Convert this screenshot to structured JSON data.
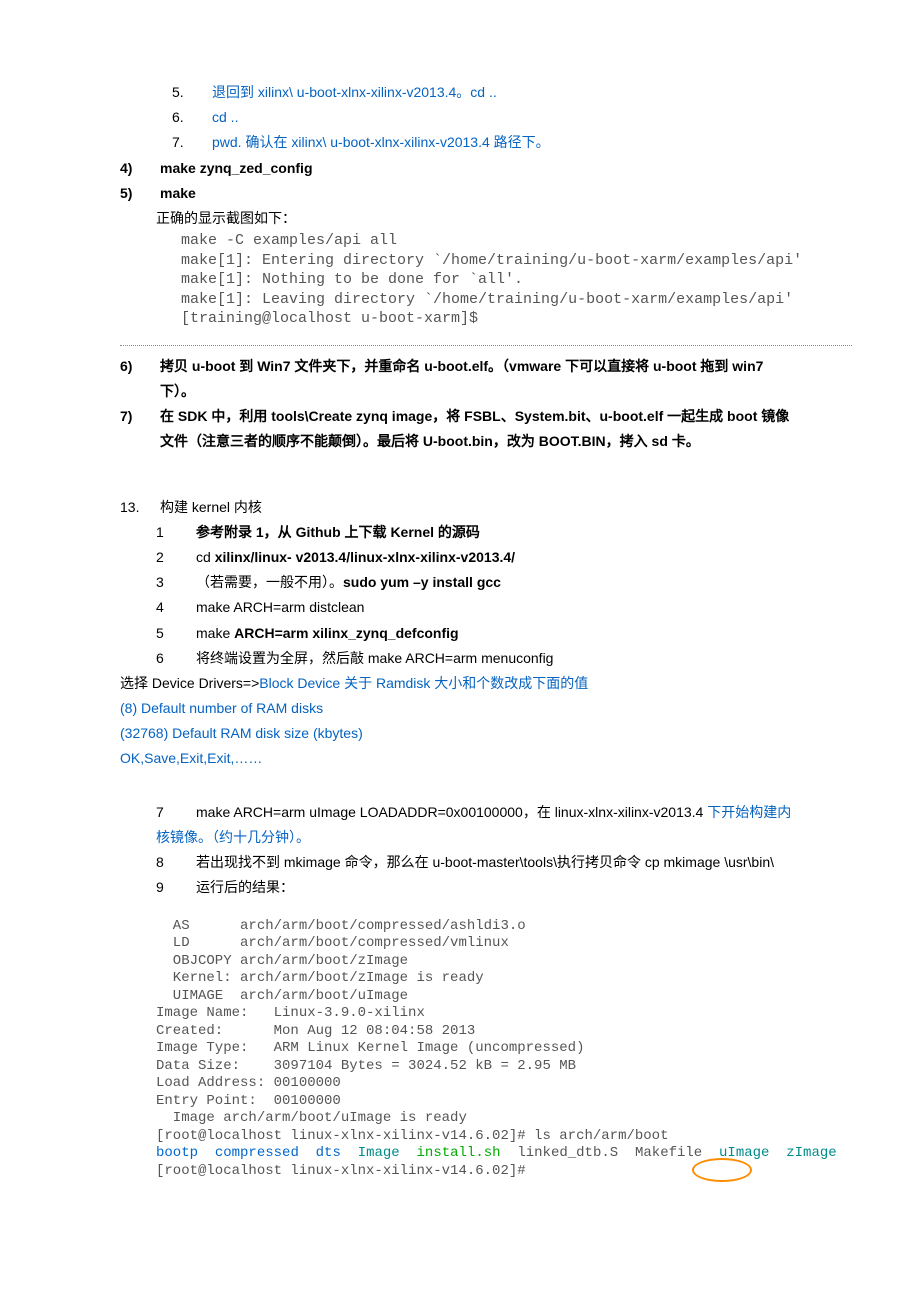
{
  "items": {
    "i5_num": "5.",
    "i5_text": "退回到 xilinx\\ u-boot-xlnx-xilinx-v2013.4。cd ..",
    "i6_num": "6.",
    "i6_text": "cd ..",
    "i7_num": "7.",
    "i7_pre": "pwd.  ",
    "i7_blue": "确认在 xilinx\\ u-boot-xlnx-xilinx-v2013.4 路径下。"
  },
  "step4_num": "4)",
  "step4_text": "make zynq_zed_config",
  "step5_num": "5)",
  "step5_text": "make",
  "step5_desc": "正确的显示截图如下：",
  "terminal1": " make -C examples/api all\n make[1]: Entering directory `/home/training/u-boot-xarm/examples/api'\n make[1]: Nothing to be done for `all'.\n make[1]: Leaving directory `/home/training/u-boot-xarm/examples/api'\n [training@localhost u-boot-xarm]$ ",
  "step6_num": "6)",
  "step6_a": "拷贝 u-boot 到 Win7 文件夹下，并重命名 u-boot.elf。（vmware 下可以直接将 u-boot 拖到 win7 下）。",
  "step7_num": "7)",
  "step7_a": "在 SDK 中，利用 tools\\Create zynq image，将 FSBL、System.bit、u-boot.elf 一起生成 boot 镜像文件（注意三者的顺序不能颠倒）。最后将 U-boot.bin，改为 BOOT.BIN，拷入 sd 卡。",
  "sec13_num": "13.",
  "sec13_title": "构建 kernel 内核",
  "k1_num": "1",
  "k1_text": "参考附录 1，从 Github 上下载 Kernel 的源码",
  "k2_num": "2",
  "k2_pre": "cd ",
  "k2_bold": "xilinx/linux- v2013.4/linux-xlnx-xilinx-v2013.4/",
  "k3_num": "3",
  "k3_pre": "（若需要，一般不用）。",
  "k3_bold": "sudo yum –y install gcc",
  "k4_num": "4",
  "k4_text": "make ARCH=arm   distclean",
  "k5_num": "5",
  "k5_pre": "make ",
  "k5_bold": "ARCH=arm xilinx_zynq_defconfig",
  "k6_num": "6",
  "k6_text": "将终端设置为全屏，然后敲  make   ARCH=arm   menuconfig",
  "choose_pre": "选择 Device Drivers=>",
  "choose_blue": "Block Device 关于 Ramdisk 大小和个数改成下面的值",
  "opt8": "(8)    Default number of RAM disks",
  "opt32768": "(32768) Default RAM disk size (kbytes)",
  "ok_line": "OK,Save,Exit,Exit,……",
  "k7_num": "7",
  "k7_a": "make ARCH=arm uImage LOADADDR=0x00100000，在 linux-xlnx-xilinx-v2013.4 ",
  "k7_b": "下开始构建内核镜像。（约十几分钟）。",
  "k8_num": "8",
  "k8_text": "若出现找不到 mkimage 命令，那么在 u-boot-master\\tools\\执行拷贝命令 cp mkimage \\usr\\bin\\",
  "k9_num": "9",
  "k9_text": "运行后的结果：",
  "term2_body": "  AS      arch/arm/boot/compressed/ashldi3.o\n  LD      arch/arm/boot/compressed/vmlinux\n  OBJCOPY arch/arm/boot/zImage\n  Kernel: arch/arm/boot/zImage is ready\n  UIMAGE  arch/arm/boot/uImage\nImage Name:   Linux-3.9.0-xilinx\nCreated:      Mon Aug 12 08:04:58 2013\nImage Type:   ARM Linux Kernel Image (uncompressed)\nData Size:    3097104 Bytes = 3024.52 kB = 2.95 MB\nLoad Address: 00100000\nEntry Point:  00100000\n  Image arch/arm/boot/uImage is ready\n[root@localhost linux-xlnx-xilinx-v14.6.02]# ls arch/arm/boot",
  "term2_ls_bootp": "bootp",
  "term2_ls_compressed": "compressed",
  "term2_ls_dts": "dts",
  "term2_ls_image": "Image",
  "term2_ls_install": "install.sh",
  "term2_ls_linked": "linked_dtb.S",
  "term2_ls_makefile": "Makefile",
  "term2_ls_uimage": "uImage",
  "term2_ls_zimage": "zImage",
  "term2_prompt": "[root@localhost linux-xlnx-xilinx-v14.6.02]# "
}
